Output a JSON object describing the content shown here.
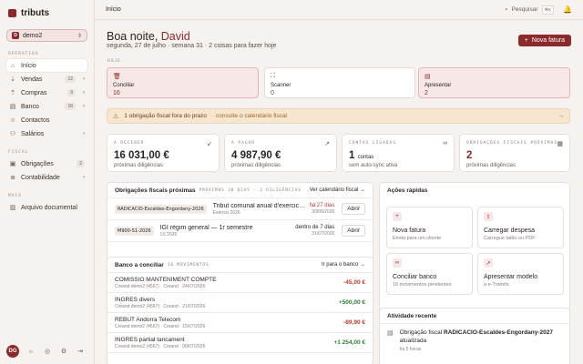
{
  "brand": {
    "name": "tributs"
  },
  "org": {
    "badge": "D",
    "name": "demo2"
  },
  "sidebar": {
    "sections": [
      {
        "label": "OPERATIVA",
        "items": [
          {
            "label": "Início",
            "icon": "home-icon",
            "glyph": "⌂",
            "active": true
          },
          {
            "label": "Vendas",
            "icon": "sales-icon",
            "glyph": "⇣",
            "count": "12",
            "arrow": true
          },
          {
            "label": "Compras",
            "icon": "cart-icon",
            "glyph": "⇡",
            "count": "9",
            "arrow": true
          },
          {
            "label": "Banco",
            "icon": "bank-icon",
            "glyph": "▤",
            "count": "16",
            "arrow": true
          },
          {
            "label": "Contactos",
            "icon": "contacts-icon",
            "glyph": "☺"
          },
          {
            "label": "Salários",
            "icon": "salary-icon",
            "glyph": "⚇",
            "arrow": true
          }
        ]
      },
      {
        "label": "FISCAL",
        "items": [
          {
            "label": "Obrigações",
            "icon": "obligations-icon",
            "glyph": "▣",
            "count": "2"
          },
          {
            "label": "Contabilidade",
            "icon": "accounting-icon",
            "glyph": "≣",
            "arrow": true
          }
        ]
      },
      {
        "label": "MAIS",
        "items": [
          {
            "label": "Arquivo documental",
            "icon": "archive-icon",
            "glyph": "▥"
          }
        ]
      }
    ],
    "footer": {
      "avatar": "DG"
    }
  },
  "topbar": {
    "title": "Início",
    "search_label": "Pesquisar",
    "shortcut": "⌘K"
  },
  "header": {
    "greeting_prefix": "Boa noite, ",
    "greeting_name": "David",
    "date": "segunda, 27 de julho",
    "week": "semana 31",
    "tasks": "2 coisas para fazer hoje",
    "new_button": "Nova fatura"
  },
  "today": {
    "label": "HOJE",
    "tiles": [
      {
        "title": "Conciliar",
        "value": "16",
        "icon": "trash-icon",
        "glyph": "🗑",
        "highlight": true
      },
      {
        "title": "Scanner",
        "value": "0",
        "icon": "scanner-icon",
        "glyph": "⛶",
        "highlight": false
      },
      {
        "title": "Apresentar",
        "value": "2",
        "icon": "present-icon",
        "glyph": "▤",
        "highlight": true
      }
    ]
  },
  "alert": {
    "title": "1 obrigação fiscal fora do prazo",
    "sub": "· consulte o calendário fiscal"
  },
  "stats": [
    {
      "label": "A RECEBER",
      "value": "16 031,00 €",
      "unit": "",
      "sub": "próximas diligências",
      "icon": "arrow-down-left-icon",
      "glyph": "↙",
      "red": false
    },
    {
      "label": "A PAGAR",
      "value": "4 987,90 €",
      "unit": "",
      "sub": "próximas diligências",
      "icon": "arrow-up-right-icon",
      "glyph": "↗",
      "red": false
    },
    {
      "label": "CONTAS LIGADAS",
      "value": "1",
      "unit": "contas",
      "sub": "sem auto-sync ativa",
      "icon": "link-icon",
      "glyph": "∞",
      "red": false
    },
    {
      "label": "OBRIGAÇÕES FISCAIS PRÓXIMAS",
      "value": "2",
      "unit": "",
      "sub": "próximas diligências",
      "icon": "calendar-icon",
      "glyph": "▦",
      "red": true
    }
  ],
  "obligations": {
    "title": "Obrigações fiscais próximas",
    "tag": "PRÓXIMOS 30 DIAS · 2 DILIGÊNCIAS",
    "link": "Ver calendário fiscal",
    "rows": [
      {
        "code": "RADICACIO-Escaldes-Engordany-2026",
        "title": "Tribut comunal anual d'exercici d'activi...",
        "sub": "Exercici 2026",
        "due": "há 27 dias",
        "date": "30/06/2026",
        "red": true,
        "action": "Abrir"
      },
      {
        "code": "M900-S1-2026",
        "title": "IGI règim general — 1r semestre",
        "sub": "1S 2026",
        "due": "dentro de 7 dias",
        "date": "31/07/2026",
        "red": false,
        "action": "Abrir"
      }
    ]
  },
  "bank": {
    "title": "Banco a conciliar",
    "tag": "16 MOVIMENTOS",
    "link": "Ir para o banco",
    "rows": [
      {
        "title": "COMISSIO MANTENIMENT COMPTE",
        "sub": "Creand demo2 (4567) · Creand · 24/07/2026",
        "amount": "-45,00 €",
        "neg": true
      },
      {
        "title": "INGRES divers",
        "sub": "Creand demo2 (4567) · Creand · 21/07/2026",
        "amount": "+500,00 €",
        "neg": false
      },
      {
        "title": "REBUT Andorra Telecom",
        "sub": "Creand demo2 (4567) · Creand · 15/07/2026",
        "amount": "-89,90 €",
        "neg": true
      },
      {
        "title": "INGRES partial tancament",
        "sub": "Creand demo2 (4567) · Creand · 09/07/2026",
        "amount": "+1 254,00 €",
        "neg": false
      }
    ]
  },
  "quick": {
    "title": "Ações rápidas",
    "items": [
      {
        "title": "Nova fatura",
        "sub": "Emita para um cliente",
        "icon": "plus-icon",
        "glyph": "+"
      },
      {
        "title": "Carregar despesa",
        "sub": "Carregue talão ou PDF",
        "icon": "upload-icon",
        "glyph": "⇪"
      },
      {
        "title": "Conciliar banco",
        "sub": "16 movimentos pendentes",
        "icon": "link-icon",
        "glyph": "∞"
      },
      {
        "title": "Apresentar modelo",
        "sub": "a e-Tramits",
        "icon": "send-icon",
        "glyph": "↗"
      }
    ]
  },
  "activity": {
    "title": "Atividade recente",
    "rows": [
      {
        "pre": "Obrigação fiscal ",
        "bold": "RADICACIO-Escaldes-Engordany-2027",
        "post": " atualizada",
        "time": "há 5 horas"
      }
    ]
  }
}
